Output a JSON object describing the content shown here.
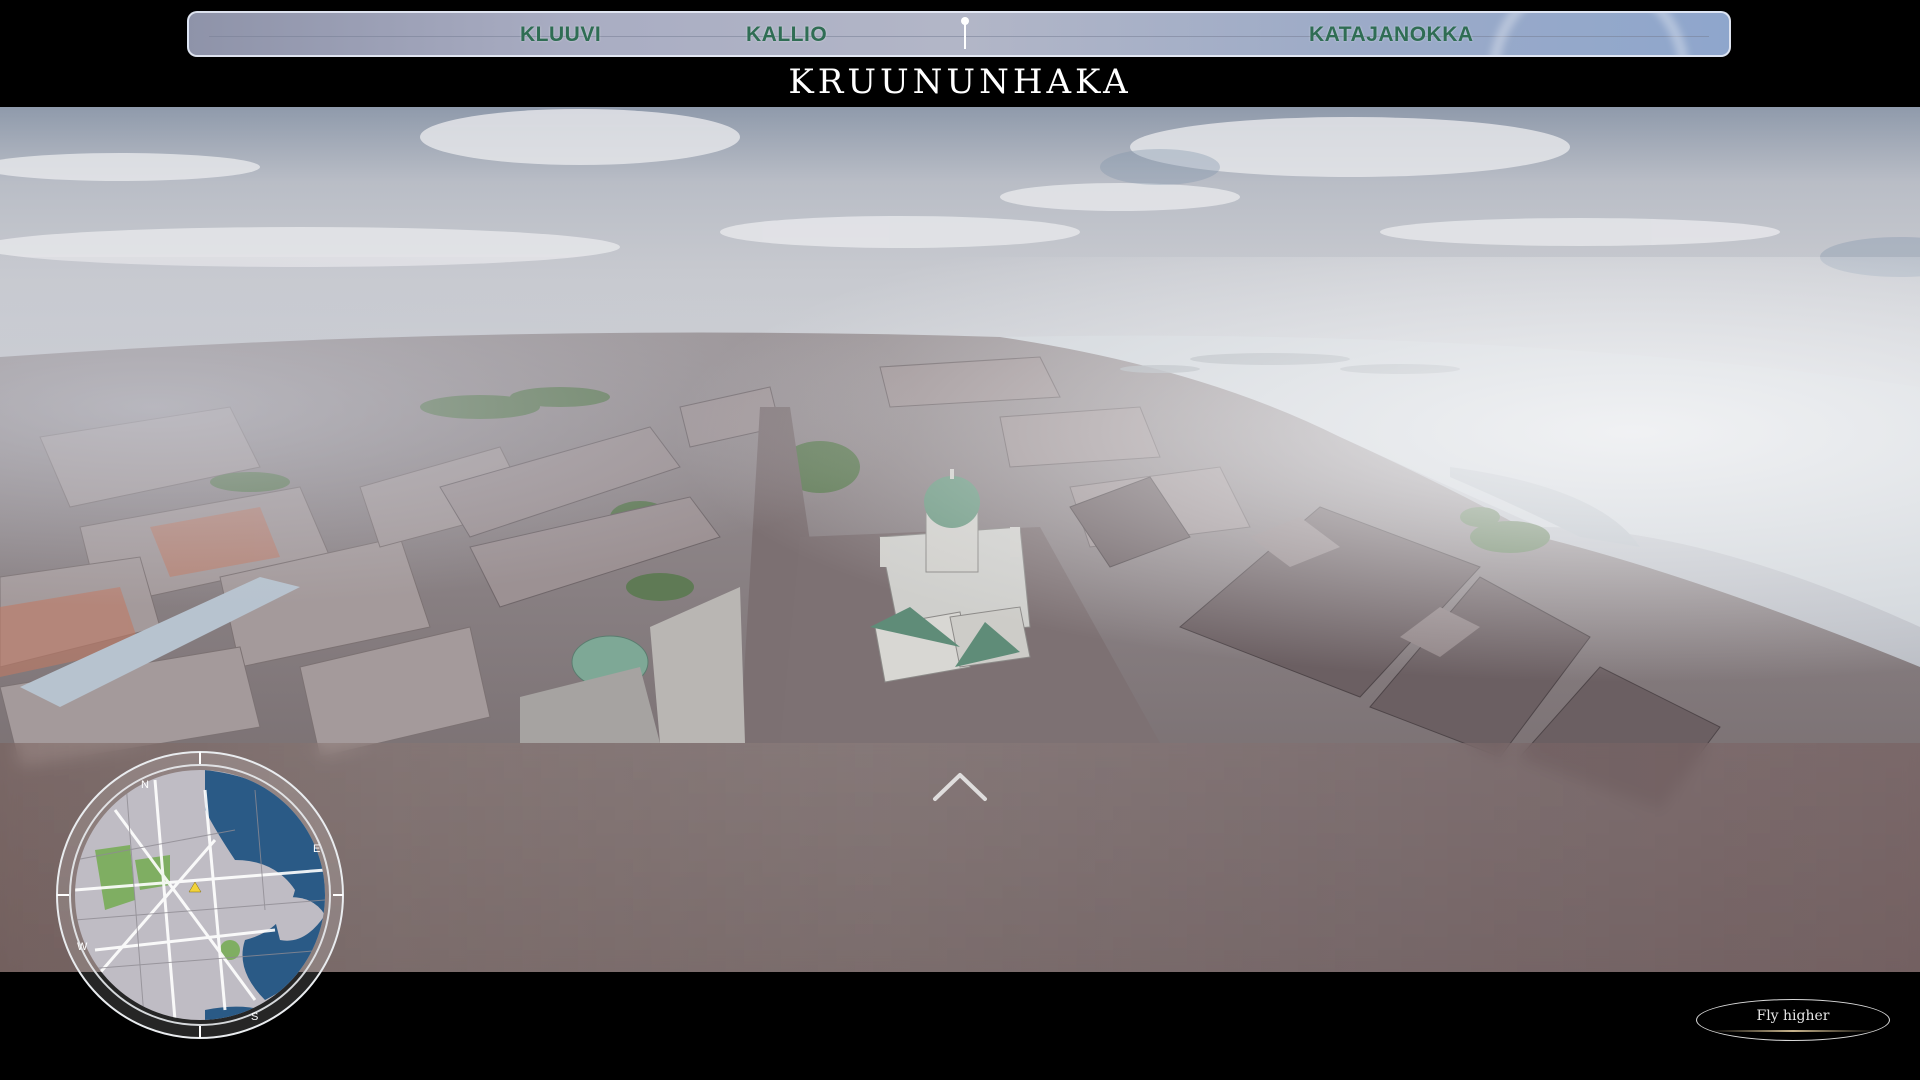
{
  "compass": {
    "districts": [
      {
        "label": "KLUUVI"
      },
      {
        "label": "KALLIO"
      },
      {
        "label": "KATAJANOKKA"
      }
    ]
  },
  "location": {
    "title": "KRUUNUNHAKA"
  },
  "minimap": {
    "directions": {
      "n": "N",
      "e": "E",
      "s": "S",
      "w": "W"
    },
    "colors": {
      "water": "#2a5a86",
      "land": "#bfbcc4",
      "park": "#7fae62",
      "ring": "#e9ecef",
      "marker": "#f2d33b"
    }
  },
  "controls": {
    "fly_higher_label": "Fly higher",
    "forward_arrow_icon": "chevron-up-icon"
  },
  "scene": {
    "landmark": "cathedral-dome",
    "sky_color": "#b9bdc6",
    "sea_color": "#c8ced4",
    "roof_color": "#8a7f80",
    "dome_color": "#6f9a84"
  }
}
